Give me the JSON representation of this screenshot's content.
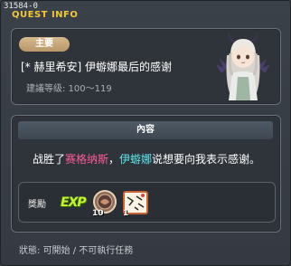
{
  "window": {
    "quest_id": "31584-0",
    "title": "QUEST INFO"
  },
  "header": {
    "category_tag": "主要",
    "quest_name": "[* 赫里希安] 伊蝣娜最后的感谢",
    "level_text": "建議等级: 100〜119"
  },
  "content": {
    "heading": "內容",
    "line_prefix": "战胜了",
    "line_enemy": "赛格纳斯",
    "line_comma": "，",
    "line_npc": "伊蝣娜",
    "line_suffix": "说想要向我表示感谢。",
    "reward_label": "獎勵",
    "exp_label": "EXP",
    "rewards": [
      {
        "icon": "coin-medal-icon",
        "count": "10"
      },
      {
        "icon": "letter-card-icon",
        "count": "1"
      }
    ]
  },
  "footer": {
    "status_text": "狀態: 可開始 / 不可執行任務"
  },
  "colors": {
    "title_gold": "#f0c838",
    "enemy_pink": "#ff5a9a",
    "npc_cyan": "#5ee8f0",
    "exp_green": "#c8f03a"
  }
}
